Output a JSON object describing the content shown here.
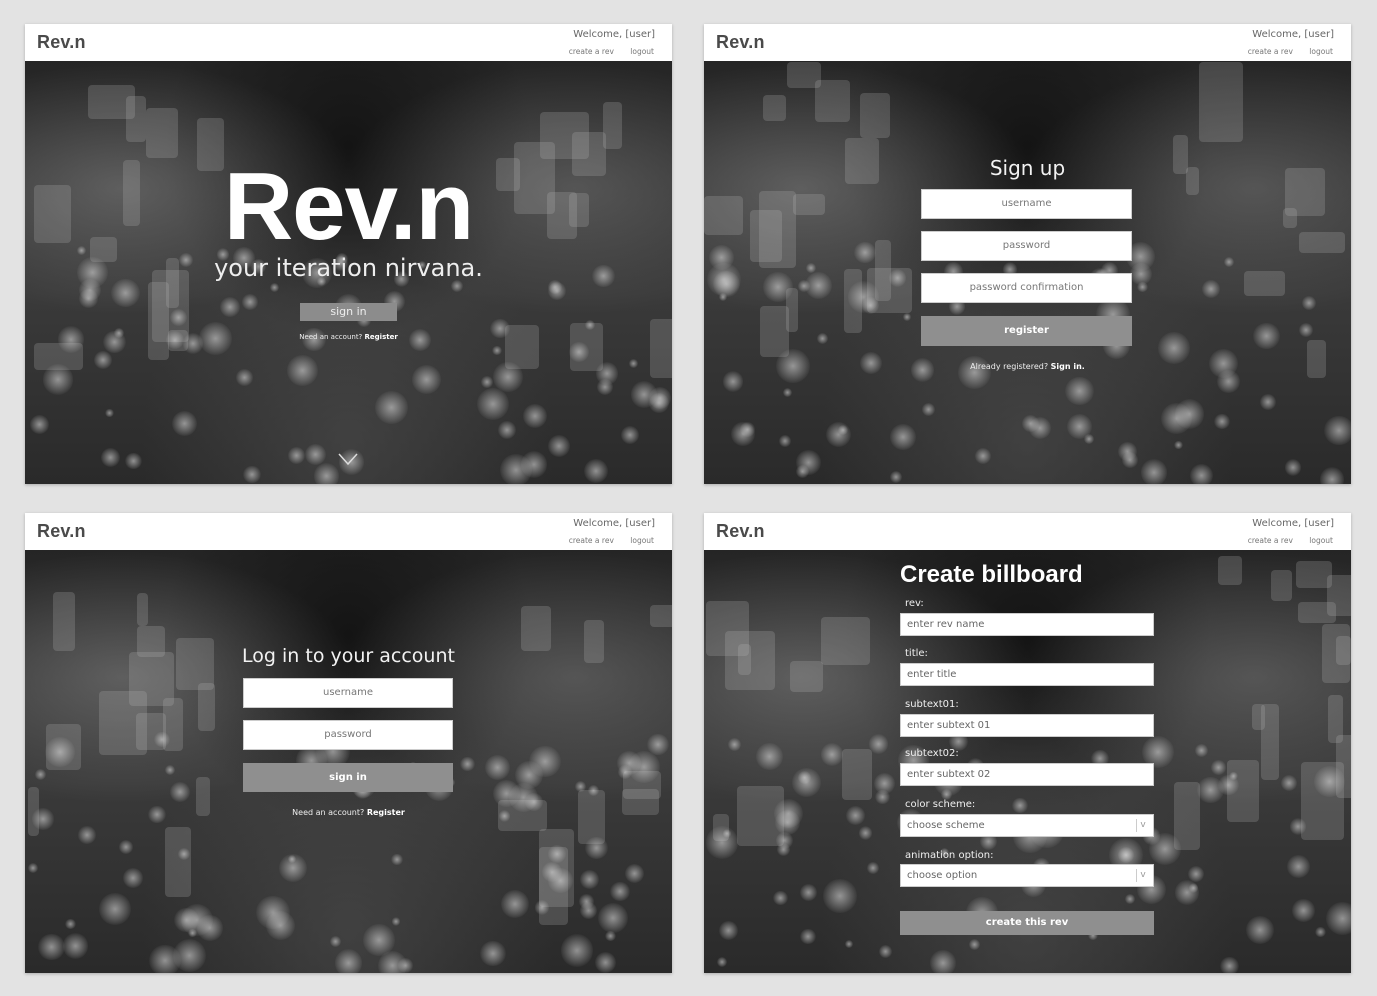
{
  "header": {
    "logo": "Rev.n",
    "welcome": "Welcome, [user]",
    "links": [
      "create a rev",
      "logout"
    ]
  },
  "landing": {
    "title": "Rev.n",
    "subtitle": "your iteration nirvana.",
    "button": "sign in",
    "prompt": "Need an account?",
    "register_link": "Register"
  },
  "signup": {
    "title": "Sign up",
    "username_placeholder": "username",
    "password_placeholder": "password",
    "confirm_placeholder": "password confirmation",
    "button": "register",
    "prompt": "Already registered?",
    "signin_link": "Sign in."
  },
  "login": {
    "title": "Log in to your account",
    "username_placeholder": "username",
    "password_placeholder": "password",
    "button": "sign in",
    "prompt": "Need an account?",
    "register_link": "Register"
  },
  "create": {
    "title": "Create billboard",
    "fields": [
      {
        "label": "rev:",
        "placeholder": "enter rev name"
      },
      {
        "label": "title:",
        "placeholder": "enter title"
      },
      {
        "label": "subtext01:",
        "placeholder": "enter subtext 01"
      },
      {
        "label": "subtext02:",
        "placeholder": "enter subtext 02"
      },
      {
        "label": "color scheme:",
        "placeholder": "choose scheme"
      },
      {
        "label": "animation option:",
        "placeholder": "choose option"
      }
    ],
    "button": "create this rev"
  }
}
